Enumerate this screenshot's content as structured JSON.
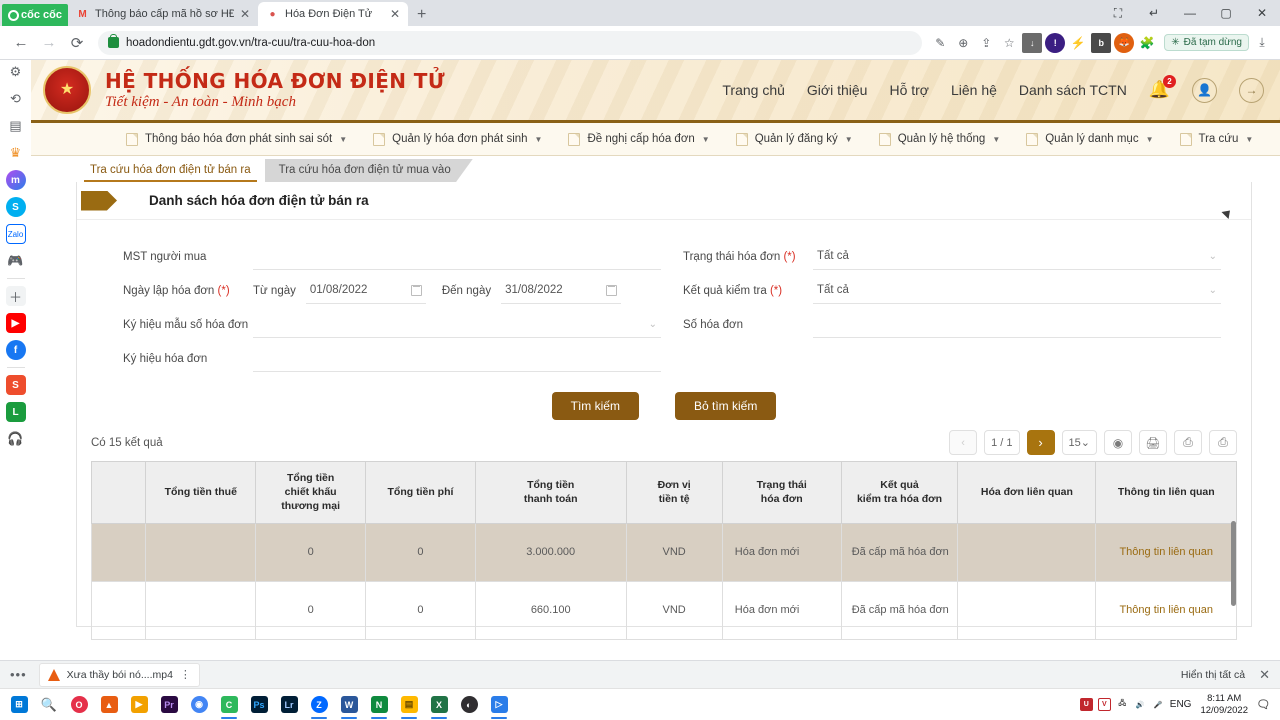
{
  "browser": {
    "brand": "cốc cốc",
    "tabs": [
      {
        "title": "Thông báo cấp mã hồ sơ HĐ",
        "favicon": "M",
        "favicon_color": "#ea4335",
        "active": false
      },
      {
        "title": "Hóa Đơn Điện Tử",
        "favicon": "●",
        "favicon_color": "#d9534f",
        "active": true
      }
    ],
    "new_tab_label": "+",
    "window_controls": [
      "screenshot-icon",
      "restore-icon",
      "minimize-icon",
      "maximize-icon",
      "close-icon"
    ],
    "back_label": "←",
    "forward_label": "→",
    "reload_label": "⟳",
    "url": "hoadondientu.gdt.gov.vn/tra-cuu/tra-cuu-hoa-don",
    "omnibox_icons": [
      "pen-icon",
      "zoom-icon",
      "share-icon",
      "bookmark-star-icon",
      "download-arrow-icon"
    ],
    "extension_icons": [
      "adblock-icon",
      "lightning-icon",
      "bitly-icon",
      "fox-icon",
      "puzzle-icon"
    ],
    "pause_badge": "Đã tạm dừng",
    "downloads_icon": "download-tray-icon",
    "sidebar_icons": [
      "gear-icon",
      "history-icon",
      "reading-list-icon",
      "crown-icon",
      "messenger-icon",
      "skype-icon",
      "zalo-icon",
      "game-icon",
      "add-icon",
      "youtube-icon",
      "facebook-icon",
      "shopee-icon",
      "lazada-icon",
      "music-icon"
    ]
  },
  "site": {
    "title_line1": "HỆ THỐNG HÓA ĐƠN ĐIỆN TỬ",
    "title_line2": "Tiết kiệm - An toàn - Minh bạch",
    "emblem_text": "THUẾ VIỆT NAM",
    "nav": [
      {
        "label": "Trang chủ"
      },
      {
        "label": "Giới thiệu"
      },
      {
        "label": "Hỗ trợ"
      },
      {
        "label": "Liên hệ"
      },
      {
        "label": "Danh sách TCTN"
      }
    ],
    "notification_count": "2",
    "account_icon": "user-icon",
    "logout_icon": "arrow-right-icon"
  },
  "menubar": [
    {
      "label": "Thông báo hóa đơn phát sinh sai sót"
    },
    {
      "label": "Quản lý hóa đơn phát sinh"
    },
    {
      "label": "Đề nghị cấp hóa đơn"
    },
    {
      "label": "Quản lý đăng ký"
    },
    {
      "label": "Quản lý hệ thống"
    },
    {
      "label": "Quản lý danh mục"
    },
    {
      "label": "Tra cứu"
    }
  ],
  "tabs": [
    {
      "label": "Tra cứu hóa đơn điện tử bán ra",
      "active": true
    },
    {
      "label": "Tra cứu hóa đơn điện tử mua vào",
      "active": false
    }
  ],
  "panel_title": "Danh sách hóa đơn điện tử bán ra",
  "form": {
    "left": {
      "mst_label": "MST người mua",
      "mst_value": "",
      "date_label": "Ngày lập hóa đơn",
      "date_required": "(*)",
      "from_label": "Từ ngày",
      "from_value": "01/08/2022",
      "to_label": "Đến ngày",
      "to_value": "31/08/2022",
      "template_label": "Ký hiệu mẫu số hóa đơn",
      "template_value": "",
      "symbol_label": "Ký hiệu hóa đơn",
      "symbol_value": ""
    },
    "right": {
      "status_label": "Trạng thái hóa đơn",
      "status_required": "(*)",
      "status_value": "Tất cả",
      "check_label": "Kết quả kiểm tra",
      "check_required": "(*)",
      "check_value": "Tất cả",
      "number_label": "Số hóa đơn",
      "number_value": ""
    },
    "search_button": "Tìm kiếm",
    "clear_button": "Bỏ tìm kiếm"
  },
  "results": {
    "count_text": "Có 15 kết quả",
    "prev_label": "‹",
    "page_label": "1 / 1",
    "next_label": "›",
    "page_size": "15",
    "action_icons": [
      "eye-icon",
      "print-icon",
      "export-excel-icon",
      "export-xml-icon"
    ]
  },
  "table": {
    "headers": [
      "",
      "Tổng tiền thuế",
      "Tổng tiền\nchiết khấu\nthương mại",
      "Tổng tiền phí",
      "Tổng tiền\nthanh toán",
      "Đơn vị\ntiền tệ",
      "Trạng thái\nhóa đơn",
      "Kết quả\nkiểm tra hóa đơn",
      "Hóa đơn liên quan",
      "Thông tin liên quan"
    ],
    "rows": [
      {
        "selected": true,
        "cells": [
          "",
          "",
          "0",
          "0",
          "3.000.000",
          "VND",
          "Hóa đơn mới",
          "Đã cấp mã hóa đơn",
          "",
          "Thông tin liên quan"
        ]
      },
      {
        "selected": false,
        "cells": [
          "",
          "",
          "0",
          "0",
          "660.100",
          "VND",
          "Hóa đơn mới",
          "Đã cấp mã hóa đơn",
          "",
          "Thông tin liên quan"
        ]
      }
    ]
  },
  "download_bar": {
    "filename": "Xưa thầy bói nó....mp4",
    "kebab": "⋮",
    "show_all": "Hiển thị tất cả",
    "close": "✕"
  },
  "taskbar": {
    "start_icon": "windows-icon",
    "search_icon": "search-icon",
    "apps": [
      {
        "name": "opera-icon",
        "color": "#e5304a",
        "glyph": "O"
      },
      {
        "name": "vlc-icon",
        "color": "#e85d12",
        "glyph": "▲"
      },
      {
        "name": "media-player-icon",
        "color": "#f2a100",
        "glyph": "▶"
      },
      {
        "name": "premiere-icon",
        "color": "#2a0a42",
        "glyph": "Pr"
      },
      {
        "name": "chrome-icon",
        "color": "#4285f4",
        "glyph": "◉"
      },
      {
        "name": "coccoc-icon",
        "color": "#2eb85c",
        "glyph": "C"
      },
      {
        "name": "photoshop-icon",
        "color": "#001e36",
        "glyph": "Ps"
      },
      {
        "name": "lightroom-icon",
        "color": "#001e36",
        "glyph": "Lr"
      },
      {
        "name": "zalo-icon",
        "color": "#0068ff",
        "glyph": "Z"
      },
      {
        "name": "word-icon",
        "color": "#2b579a",
        "glyph": "W"
      },
      {
        "name": "notepad-icon",
        "color": "#0f8a3e",
        "glyph": "N"
      },
      {
        "name": "explorer-icon",
        "color": "#ffb900",
        "glyph": "▤"
      },
      {
        "name": "excel-icon",
        "color": "#217346",
        "glyph": "X"
      },
      {
        "name": "obs-icon",
        "color": "#302e31",
        "glyph": "◐"
      },
      {
        "name": "movies-icon",
        "color": "#2b7de9",
        "glyph": "▷"
      }
    ],
    "tray_icons": [
      "unikey-icon",
      "teamviewer-icon",
      "network-icon",
      "volume-icon",
      "mic-icon"
    ],
    "language": "ENG",
    "time": "8:11 AM",
    "date": "12/09/2022",
    "action_center_icon": "notification-icon"
  }
}
